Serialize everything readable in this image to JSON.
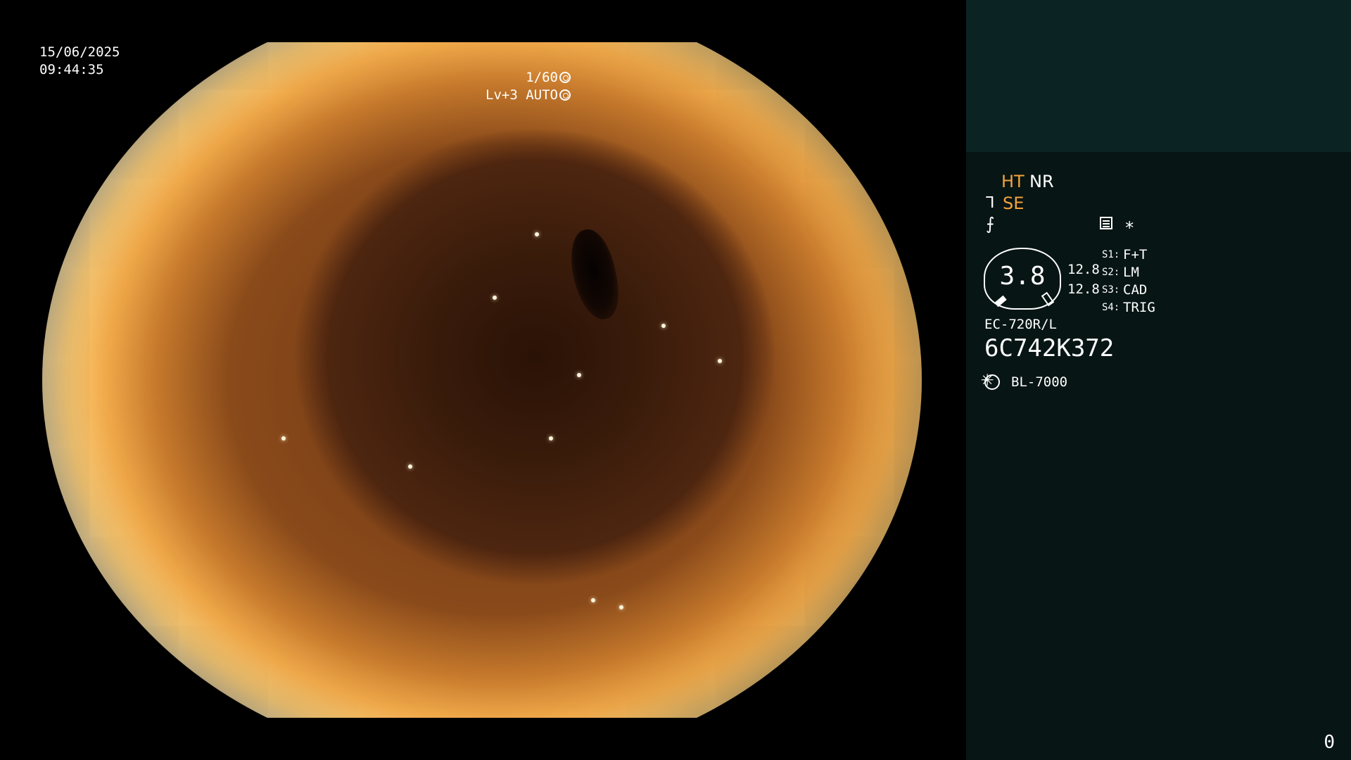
{
  "video": {
    "date": "15/06/2025",
    "time": "09:44:35",
    "shutter": "1/60",
    "level": "Lv+3",
    "mode": "AUTO"
  },
  "panel": {
    "ht": "HT",
    "nr": "NR",
    "se": "SE",
    "se_icon": "ᒣ",
    "slash_icon": "⨍",
    "star": "∗",
    "gauge_value": "3.8",
    "gauge_right_1": "12.8",
    "gauge_right_2": "12.8",
    "switches": [
      {
        "key": "S1:",
        "value": "F+T"
      },
      {
        "key": "S2:",
        "value": "LM"
      },
      {
        "key": "S3:",
        "value": "CAD"
      },
      {
        "key": "S4:",
        "value": "TRIG"
      }
    ],
    "model": "EC-720R/L",
    "serial": "6C742K372",
    "light_source": "BL-7000",
    "counter": "0"
  },
  "colors": {
    "accent_orange": "#f3a33c",
    "panel_bg": "#071514",
    "panel_top": "#0c2324"
  }
}
